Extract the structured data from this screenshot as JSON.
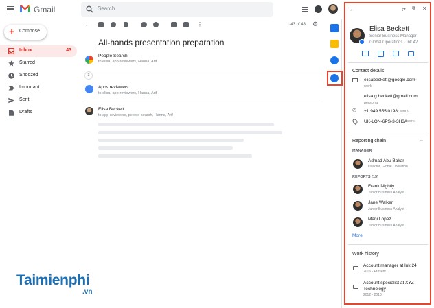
{
  "app": {
    "name": "Gmail"
  },
  "search": {
    "placeholder": "Search"
  },
  "compose": {
    "label": "Compose"
  },
  "nav": [
    {
      "label": "Inbox",
      "count": "43",
      "icon": "inbox-icon"
    },
    {
      "label": "Starred",
      "count": "",
      "icon": "star-icon"
    },
    {
      "label": "Snoozed",
      "count": "",
      "icon": "clock-icon"
    },
    {
      "label": "Important",
      "count": "",
      "icon": "label-important-icon"
    },
    {
      "label": "Sent",
      "count": "",
      "icon": "send-icon"
    },
    {
      "label": "Drafts",
      "count": "",
      "icon": "draft-icon"
    }
  ],
  "toolbar": {
    "range": "1-43 of 43"
  },
  "thread": {
    "subject": "All-hands presentation preparation",
    "collapsed_count": "3",
    "messages": [
      {
        "sender": "People Search",
        "to": "to elisa, app-reviewers, Hanna, Arif"
      },
      {
        "sender": "Apps reviewers",
        "to": "to elisa, app-reviewers, Hanna, Arif"
      },
      {
        "sender": "Elisa Beckett",
        "to": "to app-reviewers, people-search, Hanna, Arif"
      }
    ]
  },
  "panel": {
    "name": "Elisa Beckett",
    "title": "Senior Business Manager",
    "location": "Global Operations",
    "office": "Ink 42",
    "contact": {
      "heading": "Contact details",
      "email1": "elisabeckett@google.com",
      "email1_type": "work",
      "email2": "elisa.g.beckett@gmail.com",
      "email2_type": "personal",
      "phone": "+1 949 555 0198",
      "phone_type": "work",
      "desk": "UK-LON-6PS-3-3H3A",
      "desk_type": "work"
    },
    "reporting": {
      "heading": "Reporting chain",
      "manager_label": "MANAGER",
      "manager": {
        "name": "Admad Abu Bakar",
        "role": "Director, Global Operation"
      },
      "reports_label": "REPORTS (15)",
      "reports": [
        {
          "name": "Frank Nightly",
          "role": "Junior Business Analyst"
        },
        {
          "name": "Jane Walker",
          "role": "Junior Business Analyst"
        },
        {
          "name": "Mani Lopez",
          "role": "Junior Business Analyst"
        }
      ],
      "more": "More"
    },
    "work_history": {
      "heading": "Work history",
      "items": [
        {
          "title": "Account manager at Ink 24",
          "dates": "2016 - Present"
        },
        {
          "title": "Account specialist at XYZ Technology",
          "dates": "2012 - 2016"
        }
      ]
    }
  },
  "watermark": {
    "text": "Taimienphi",
    "suffix": ".vn"
  },
  "colors": {
    "accent_red": "#d93025",
    "highlight_border": "#e8452c",
    "link_blue": "#1a73e8"
  }
}
